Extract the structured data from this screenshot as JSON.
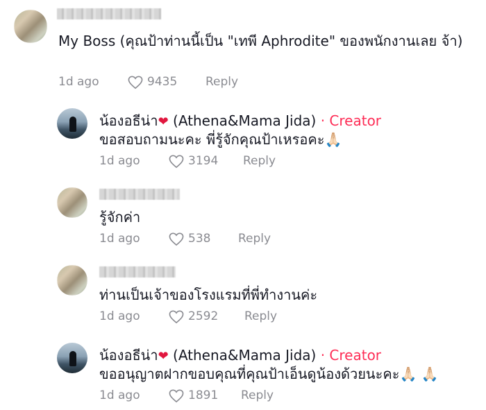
{
  "comments": [
    {
      "text": "My Boss (คุณป้าท่านนี้เป็น \"เทพี Aphrodite\" ของพนักงานเลย จ้า)",
      "time": "1d ago",
      "likes": "9435",
      "reply": "Reply"
    },
    {
      "author": "น้องอธีน่า",
      "author_suffix": "(Athena&Mama Jida)",
      "creator_label": "· Creator",
      "text": "ขอสอบถามนะคะ พี่รู้จักคุณป้าเหรอคะ🙏🏻",
      "time": "1d ago",
      "likes": "3194",
      "reply": "Reply"
    },
    {
      "text": "รู้จักค่า",
      "time": "1d ago",
      "likes": "538",
      "reply": "Reply"
    },
    {
      "text": "ท่านเป็นเจ้าของโรงแรมที่พี่ทำงานค่ะ",
      "time": "1d ago",
      "likes": "2592",
      "reply": "Reply"
    },
    {
      "author": "น้องอธีน่า",
      "author_suffix": "(Athena&Mama Jida)",
      "creator_label": "· Creator",
      "text": "ขออนุญาตฝากขอบคุณที่คุณป้าเอ็นดูน้องด้วยนะคะ🙏🏻 🙏🏻",
      "time": "1d ago",
      "likes": "1891",
      "reply": "Reply"
    }
  ],
  "colors": {
    "creator": "#fe2c55",
    "meta": "#8a8b91",
    "text": "#161823"
  }
}
